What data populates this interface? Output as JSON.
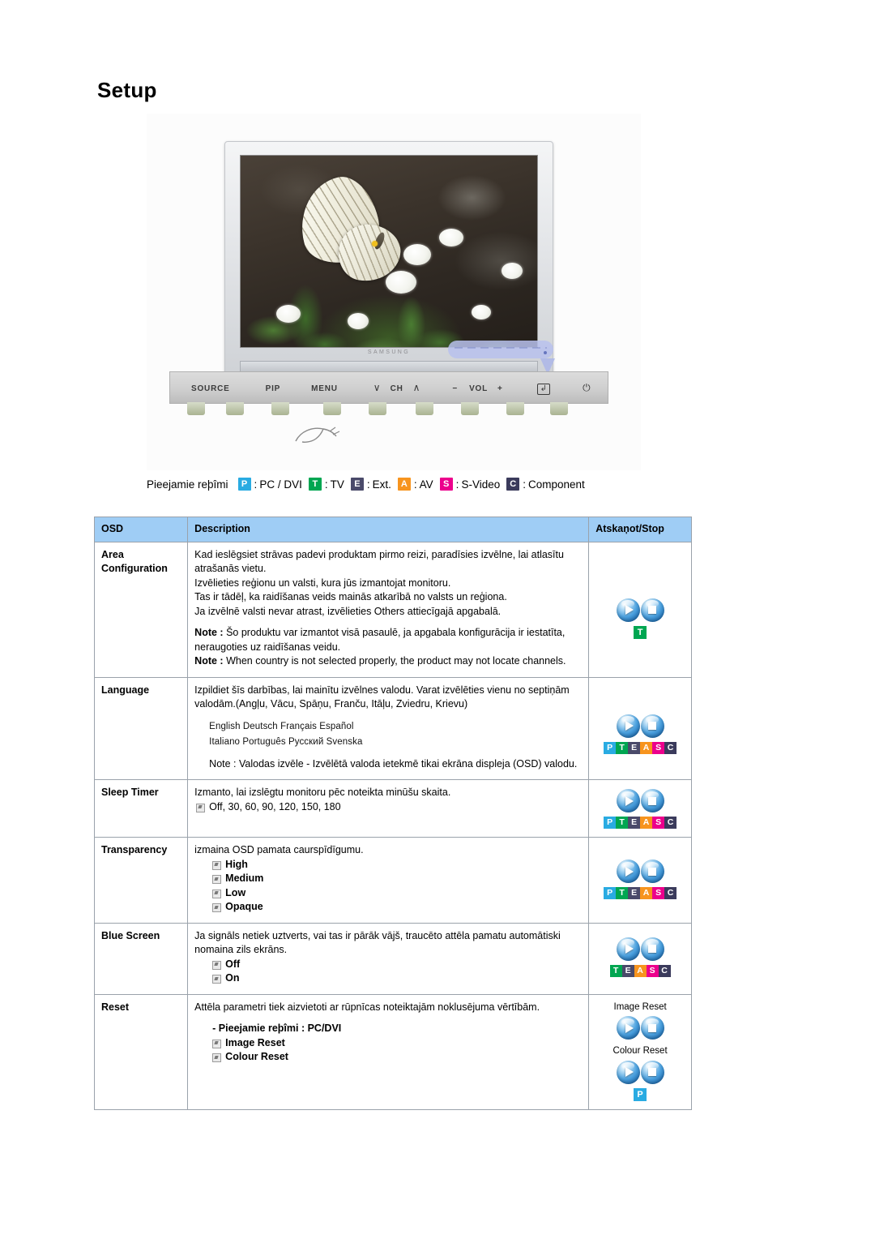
{
  "page_title": "Setup",
  "illustration": {
    "brand": "SAMSUNG",
    "screen_caption": "butterfly on white flowers photo",
    "controls": [
      {
        "name": "source-button",
        "label": "SOURCE"
      },
      {
        "name": "pip-button",
        "label": "PIP"
      },
      {
        "name": "menu-button",
        "label": "MENU"
      },
      {
        "name": "channel-down-icon",
        "label": "∨"
      },
      {
        "name": "channel-label",
        "label": "CH"
      },
      {
        "name": "channel-up-icon",
        "label": "∧"
      },
      {
        "name": "volume-down-icon",
        "label": "−"
      },
      {
        "name": "volume-label",
        "label": "VOL"
      },
      {
        "name": "volume-up-icon",
        "label": "+"
      },
      {
        "name": "enter-button",
        "label": "↲"
      },
      {
        "name": "power-button",
        "label": "⏻"
      }
    ]
  },
  "legend": {
    "prefix": "Pieejamie reþîmi",
    "separator": ":",
    "items": [
      {
        "code": "P",
        "label": "PC / DVI",
        "color": "#29abe2"
      },
      {
        "code": "T",
        "label": "TV",
        "color": "#00a651"
      },
      {
        "code": "E",
        "label": "Ext.",
        "color": "#4a4a6a"
      },
      {
        "code": "A",
        "label": "AV",
        "color": "#f7941e"
      },
      {
        "code": "S",
        "label": "S-Video",
        "color": "#ec008c"
      },
      {
        "code": "C",
        "label": "Component",
        "color": "#3b3b5c"
      }
    ]
  },
  "table": {
    "headers": {
      "osd": "OSD",
      "description": "Description",
      "action": "Atskaņot/Stop"
    },
    "rows": [
      {
        "osd": "Area Configuration",
        "osd_line1": "Area",
        "osd_line2": "Configuration",
        "paragraphs": [
          "Kad ieslēgsiet strāvas padevi produktam pirmo reizi, paradīsies izvēlne, lai atlasītu atrašanās vietu.",
          "Izvēlieties reģionu un valsti, kura jūs izmantojat monitoru.",
          "Tas ir tādēļ, ka raidīšanas veids mainās atkarībā no valsts un reģiona.",
          "Ja izvēlnē valsti nevar atrast, izvēlieties Others attiecīgajā apgabalā."
        ],
        "notes": [
          {
            "label": "Note :",
            "text": " Šo produktu var izmantot visā pasaulē, ja apgabala konfigurācija ir iestatīta, neraugoties uz raidīšanas veidu."
          },
          {
            "label": "Note :",
            "text": " When country is not selected properly, the product may not locate channels."
          }
        ],
        "action": {
          "orbs": true,
          "badges": [
            "T"
          ]
        }
      },
      {
        "osd": "Language",
        "paragraphs": [
          "Izpildiet šīs darbības, lai mainītu izvēlnes valodu. Varat izvēlēties vienu no septiņām valodām.(Angļu, Vācu, Spāņu, Franču, Itāļu, Zviedru, Krievu)"
        ],
        "language_rows": [
          "English  Deutsch  Français  Español",
          "Italiano  Português  Русский  Svenska"
        ],
        "note_plain": "Note : Valodas izvēle - Izvēlētā valoda ietekmē tikai ekrāna displeja (OSD) valodu.",
        "action": {
          "orbs": true,
          "badges": [
            "P",
            "T",
            "E",
            "A",
            "S",
            "C"
          ]
        }
      },
      {
        "osd": "Sleep Timer",
        "paragraphs": [
          "Izmanto, lai izslēgtu monitoru pēc noteikta minūšu skaita."
        ],
        "bullets": [
          {
            "text": "Off, 30, 60, 90, 120, 150, 180",
            "bold": false,
            "indent": false
          }
        ],
        "action": {
          "orbs": true,
          "badges": [
            "P",
            "T",
            "E",
            "A",
            "S",
            "C"
          ]
        }
      },
      {
        "osd": "Transparency",
        "paragraphs": [
          "izmaina OSD pamata caurspīdīgumu."
        ],
        "bullets": [
          {
            "text": "High",
            "bold": true,
            "indent": true
          },
          {
            "text": "Medium",
            "bold": true,
            "indent": true
          },
          {
            "text": "Low",
            "bold": true,
            "indent": true
          },
          {
            "text": "Opaque",
            "bold": true,
            "indent": true
          }
        ],
        "action": {
          "orbs": true,
          "badges": [
            "P",
            "T",
            "E",
            "A",
            "S",
            "C"
          ]
        }
      },
      {
        "osd": "Blue Screen",
        "paragraphs": [
          "Ja signāls netiek uztverts, vai tas ir pārāk vājš, traucēto attēla pamatu automātiski nomaina zils ekrāns."
        ],
        "bullets": [
          {
            "text": "Off",
            "bold": true,
            "indent": true
          },
          {
            "text": "On",
            "bold": true,
            "indent": true
          }
        ],
        "action": {
          "orbs": true,
          "badges": [
            "T",
            "E",
            "A",
            "S",
            "C"
          ]
        }
      },
      {
        "osd": "Reset",
        "paragraphs": [
          "Attēla parametri tiek aizvietoti ar rūpnīcas noteiktajām noklusējuma vērtībām."
        ],
        "subheading": "- Pieejamie reþîmi : PC/DVI",
        "bullets": [
          {
            "text": "Image Reset",
            "bold": true,
            "indent": true
          },
          {
            "text": "Colour Reset",
            "bold": true,
            "indent": true
          }
        ],
        "action": {
          "labelled_orbs": [
            "Image Reset",
            "Colour Reset"
          ],
          "badges": [
            "P"
          ]
        }
      }
    ]
  },
  "badge_colors": {
    "P": "#29abe2",
    "T": "#00a651",
    "E": "#4a4a6a",
    "A": "#f7941e",
    "S": "#ec008c",
    "C": "#3b3b5c"
  }
}
